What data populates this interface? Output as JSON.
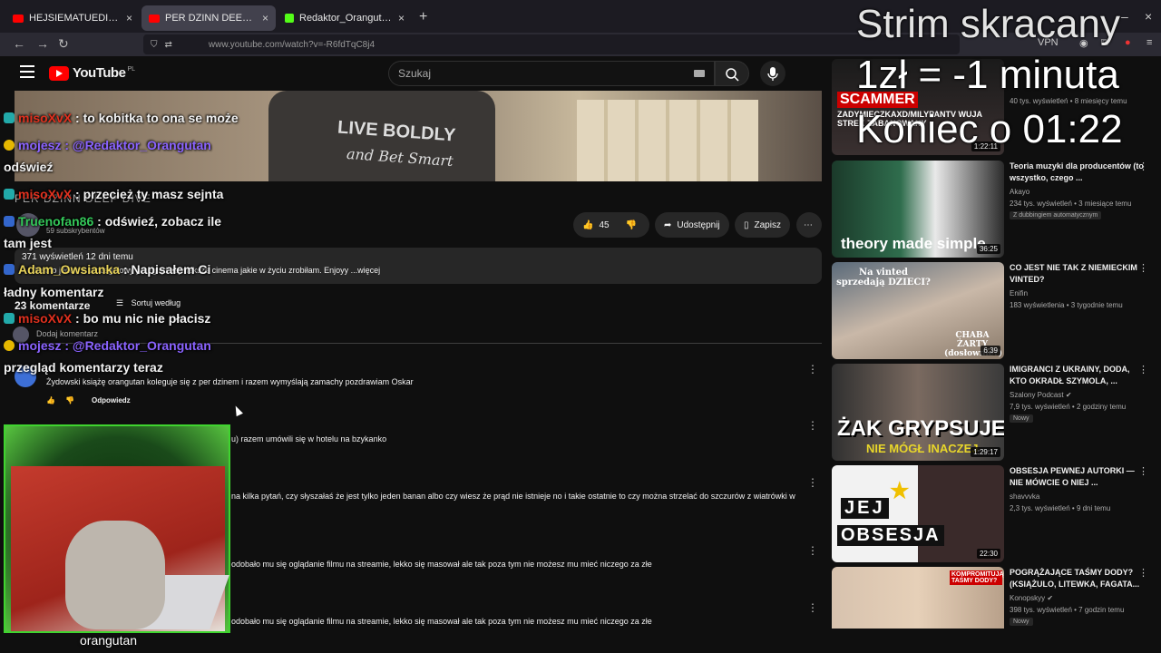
{
  "browser": {
    "tabs": [
      {
        "title": "HEJSIEMATUEDI ICEBERG - CZE",
        "color": "#ff0000"
      },
      {
        "title": "PER DZINN DEEP DIVE - YouTub",
        "color": "#ff0000"
      },
      {
        "title": "Redaktor_Orangutan Stream - V",
        "color": "#53fc18"
      }
    ],
    "url": "www.youtube.com/watch?v=-R6fdTqC8j4",
    "vpn_label": "VPN"
  },
  "youtube": {
    "logo_text": "YouTube",
    "region": "PL",
    "search_placeholder": "Szukaj"
  },
  "video": {
    "shirt_line1": "LIVE BOLDLY",
    "shirt_line2": "and Bet Smart",
    "channel_title": "PER DZINN DEEP DIVE",
    "subscribers": "59 subskrybentów",
    "likes": "45",
    "share_label": "Udostępnij",
    "save_label": "Zapisz",
    "views_date": "371 wyświetleń  12 dni temu",
    "description": "Jest to jeden z szczegółowy przegląd najwieksze cinema jakie w życiu zrobiłam. Enjoyy ...więcej"
  },
  "comments": {
    "count": "23 komentarze",
    "sort_label": "Sortuj według",
    "add_placeholder": "Dodaj komentarz",
    "reply_label": "Odpowiedz",
    "items": [
      "Żydowski książę orangutan koleguje się z per dzinem i razem wymyślają zamachy pozdrawiam Oskar",
      "u) razem umówili się w hotelu na bzykanko",
      "na kilka pytań, czy słyszałaś że jest tylko jeden banan albo czy wiesz że prąd nie istnieje no i takie ostatnie to czy można strzelać do szczurów z wiatrówki w",
      "odobało mu się oglądanie filmu na streamie, lekko się masował ale tak poza tym nie możesz mu mieć niczego za złe",
      "odobało mu się oglądanie filmu na streamie, lekko się masował ale tak poza tym nie możesz mu mieć niczego za złe"
    ]
  },
  "related": [
    {
      "title": "",
      "channel": "",
      "meta": "40 tys. wyświetleń • 8 miesięcy temu",
      "duration": "1:22:11",
      "thumb_text": "SCAMMER",
      "thumb_sub": "ZADYMIECZKAXD/MILYPANTV WUJA STREK ZABANOWANY"
    },
    {
      "title": "Teoria muzyki dla producentów (to wszystko, czego ...",
      "channel": "Akayo",
      "meta": "234 tys. wyświetleń • 3 miesiące temu",
      "badge": "Z dubbingiem automatycznym",
      "duration": "36:25",
      "thumb_text": "theory made simple"
    },
    {
      "title": "CO JEST NIE TAK Z NIEMIECKIM VINTED?",
      "channel": "Enifin",
      "meta": "183 wyświetlenia • 3 tygodnie temu",
      "duration": "6:39",
      "thumb_text": "Na vinted sprzedają DZIECI?",
      "thumb_sub": "CHABA ŻARTY (dosłownie?)"
    },
    {
      "title": "IMIGRANCI Z UKRAINY, DODA, KTO OKRADŁ SZYMOLA, ...",
      "channel": "Szalony Podcast",
      "meta": "7,9 tys. wyświetleń • 2 godziny temu",
      "badge": "Nowy",
      "duration": "1:29:17",
      "thumb_text": "ŻAK GRYPSUJE",
      "thumb_sub": "NIE MÓGŁ INACZEJ"
    },
    {
      "title": "OBSESJA PEWNEJ AUTORKI — NIE MÓWCIE O NIEJ ...",
      "channel": "shavvvka",
      "meta": "2,3 tys. wyświetleń • 9 dni temu",
      "duration": "22:30",
      "thumb_text": "JEJ",
      "thumb_sub": "OBSESJA"
    },
    {
      "title": "POGRĄŻAJĄCE TAŚMY DODY? (KSIĄŻULO, LITEWKA, FAGATA...",
      "channel": "Konopskyy",
      "meta": "398 tys. wyświetleń • 7 godzin temu",
      "badge": "Nowy",
      "thumb_text": "KOMPROMITUJĄCE TAŚMY DODY?"
    }
  ],
  "overlay": {
    "strim": "Strim skracany",
    "rate": "1zł = -1 minuta",
    "end": "Koniec o 01:22",
    "cam_label": "orangutan"
  },
  "chat": [
    {
      "user": "misoXvX",
      "msg": ": to kobitka to ona se może"
    },
    {
      "user": "mojesz",
      "msg": ": @Redaktor_Orangutan"
    },
    {
      "user": "",
      "msg": "odświeź"
    },
    {
      "user": "misoXvX",
      "msg": ": przecież ty masz sejnta"
    },
    {
      "user": "Truenofan86",
      "msg": ": odświeź, zobacz ile"
    },
    {
      "user": "",
      "msg": "tam jest"
    },
    {
      "user": "Adam_Owsianka",
      "msg": ": Napisałem Ci"
    },
    {
      "user": "",
      "msg": "ładny komentarz"
    },
    {
      "user": "misoXvX",
      "msg": ": bo mu nic nie płacisz"
    },
    {
      "user": "mojesz",
      "msg": ": @Redaktor_Orangutan"
    },
    {
      "user": "",
      "msg": "przegląd komentarzy teraz"
    }
  ]
}
